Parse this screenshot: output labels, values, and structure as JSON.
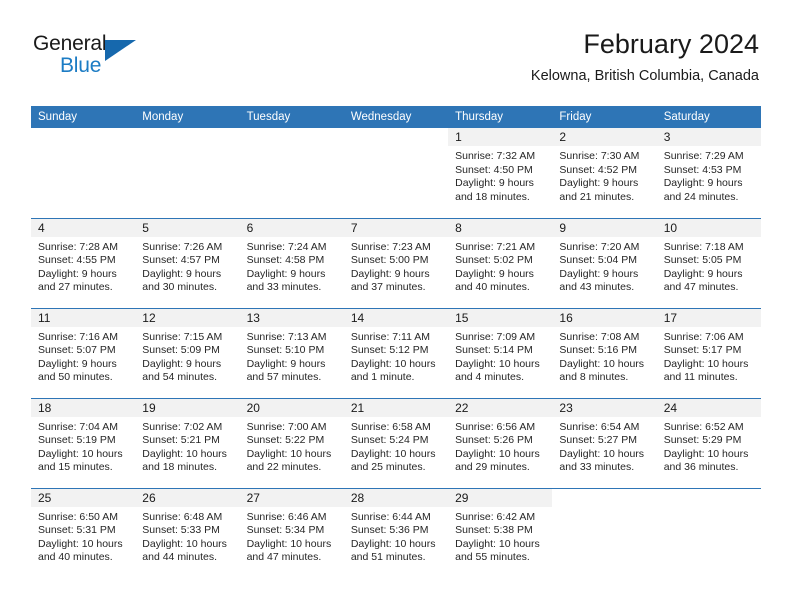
{
  "brand": {
    "name_part1": "General",
    "name_part2": "Blue",
    "accent_color": "#1668ad"
  },
  "header": {
    "title": "February 2024",
    "location": "Kelowna, British Columbia, Canada",
    "header_bg_color": "#2e75b6",
    "daynum_bg_color": "#f2f2f2"
  },
  "weekdays": [
    "Sunday",
    "Monday",
    "Tuesday",
    "Wednesday",
    "Thursday",
    "Friday",
    "Saturday"
  ],
  "weeks": [
    [
      {
        "day": "",
        "empty": true
      },
      {
        "day": "",
        "empty": true
      },
      {
        "day": "",
        "empty": true
      },
      {
        "day": "",
        "empty": true
      },
      {
        "day": "1",
        "sunrise": "Sunrise: 7:32 AM",
        "sunset": "Sunset: 4:50 PM",
        "daylight_line1": "Daylight: 9 hours",
        "daylight_line2": "and 18 minutes."
      },
      {
        "day": "2",
        "sunrise": "Sunrise: 7:30 AM",
        "sunset": "Sunset: 4:52 PM",
        "daylight_line1": "Daylight: 9 hours",
        "daylight_line2": "and 21 minutes."
      },
      {
        "day": "3",
        "sunrise": "Sunrise: 7:29 AM",
        "sunset": "Sunset: 4:53 PM",
        "daylight_line1": "Daylight: 9 hours",
        "daylight_line2": "and 24 minutes."
      }
    ],
    [
      {
        "day": "4",
        "sunrise": "Sunrise: 7:28 AM",
        "sunset": "Sunset: 4:55 PM",
        "daylight_line1": "Daylight: 9 hours",
        "daylight_line2": "and 27 minutes."
      },
      {
        "day": "5",
        "sunrise": "Sunrise: 7:26 AM",
        "sunset": "Sunset: 4:57 PM",
        "daylight_line1": "Daylight: 9 hours",
        "daylight_line2": "and 30 minutes."
      },
      {
        "day": "6",
        "sunrise": "Sunrise: 7:24 AM",
        "sunset": "Sunset: 4:58 PM",
        "daylight_line1": "Daylight: 9 hours",
        "daylight_line2": "and 33 minutes."
      },
      {
        "day": "7",
        "sunrise": "Sunrise: 7:23 AM",
        "sunset": "Sunset: 5:00 PM",
        "daylight_line1": "Daylight: 9 hours",
        "daylight_line2": "and 37 minutes."
      },
      {
        "day": "8",
        "sunrise": "Sunrise: 7:21 AM",
        "sunset": "Sunset: 5:02 PM",
        "daylight_line1": "Daylight: 9 hours",
        "daylight_line2": "and 40 minutes."
      },
      {
        "day": "9",
        "sunrise": "Sunrise: 7:20 AM",
        "sunset": "Sunset: 5:04 PM",
        "daylight_line1": "Daylight: 9 hours",
        "daylight_line2": "and 43 minutes."
      },
      {
        "day": "10",
        "sunrise": "Sunrise: 7:18 AM",
        "sunset": "Sunset: 5:05 PM",
        "daylight_line1": "Daylight: 9 hours",
        "daylight_line2": "and 47 minutes."
      }
    ],
    [
      {
        "day": "11",
        "sunrise": "Sunrise: 7:16 AM",
        "sunset": "Sunset: 5:07 PM",
        "daylight_line1": "Daylight: 9 hours",
        "daylight_line2": "and 50 minutes."
      },
      {
        "day": "12",
        "sunrise": "Sunrise: 7:15 AM",
        "sunset": "Sunset: 5:09 PM",
        "daylight_line1": "Daylight: 9 hours",
        "daylight_line2": "and 54 minutes."
      },
      {
        "day": "13",
        "sunrise": "Sunrise: 7:13 AM",
        "sunset": "Sunset: 5:10 PM",
        "daylight_line1": "Daylight: 9 hours",
        "daylight_line2": "and 57 minutes."
      },
      {
        "day": "14",
        "sunrise": "Sunrise: 7:11 AM",
        "sunset": "Sunset: 5:12 PM",
        "daylight_line1": "Daylight: 10 hours",
        "daylight_line2": "and 1 minute."
      },
      {
        "day": "15",
        "sunrise": "Sunrise: 7:09 AM",
        "sunset": "Sunset: 5:14 PM",
        "daylight_line1": "Daylight: 10 hours",
        "daylight_line2": "and 4 minutes."
      },
      {
        "day": "16",
        "sunrise": "Sunrise: 7:08 AM",
        "sunset": "Sunset: 5:16 PM",
        "daylight_line1": "Daylight: 10 hours",
        "daylight_line2": "and 8 minutes."
      },
      {
        "day": "17",
        "sunrise": "Sunrise: 7:06 AM",
        "sunset": "Sunset: 5:17 PM",
        "daylight_line1": "Daylight: 10 hours",
        "daylight_line2": "and 11 minutes."
      }
    ],
    [
      {
        "day": "18",
        "sunrise": "Sunrise: 7:04 AM",
        "sunset": "Sunset: 5:19 PM",
        "daylight_line1": "Daylight: 10 hours",
        "daylight_line2": "and 15 minutes."
      },
      {
        "day": "19",
        "sunrise": "Sunrise: 7:02 AM",
        "sunset": "Sunset: 5:21 PM",
        "daylight_line1": "Daylight: 10 hours",
        "daylight_line2": "and 18 minutes."
      },
      {
        "day": "20",
        "sunrise": "Sunrise: 7:00 AM",
        "sunset": "Sunset: 5:22 PM",
        "daylight_line1": "Daylight: 10 hours",
        "daylight_line2": "and 22 minutes."
      },
      {
        "day": "21",
        "sunrise": "Sunrise: 6:58 AM",
        "sunset": "Sunset: 5:24 PM",
        "daylight_line1": "Daylight: 10 hours",
        "daylight_line2": "and 25 minutes."
      },
      {
        "day": "22",
        "sunrise": "Sunrise: 6:56 AM",
        "sunset": "Sunset: 5:26 PM",
        "daylight_line1": "Daylight: 10 hours",
        "daylight_line2": "and 29 minutes."
      },
      {
        "day": "23",
        "sunrise": "Sunrise: 6:54 AM",
        "sunset": "Sunset: 5:27 PM",
        "daylight_line1": "Daylight: 10 hours",
        "daylight_line2": "and 33 minutes."
      },
      {
        "day": "24",
        "sunrise": "Sunrise: 6:52 AM",
        "sunset": "Sunset: 5:29 PM",
        "daylight_line1": "Daylight: 10 hours",
        "daylight_line2": "and 36 minutes."
      }
    ],
    [
      {
        "day": "25",
        "sunrise": "Sunrise: 6:50 AM",
        "sunset": "Sunset: 5:31 PM",
        "daylight_line1": "Daylight: 10 hours",
        "daylight_line2": "and 40 minutes."
      },
      {
        "day": "26",
        "sunrise": "Sunrise: 6:48 AM",
        "sunset": "Sunset: 5:33 PM",
        "daylight_line1": "Daylight: 10 hours",
        "daylight_line2": "and 44 minutes."
      },
      {
        "day": "27",
        "sunrise": "Sunrise: 6:46 AM",
        "sunset": "Sunset: 5:34 PM",
        "daylight_line1": "Daylight: 10 hours",
        "daylight_line2": "and 47 minutes."
      },
      {
        "day": "28",
        "sunrise": "Sunrise: 6:44 AM",
        "sunset": "Sunset: 5:36 PM",
        "daylight_line1": "Daylight: 10 hours",
        "daylight_line2": "and 51 minutes."
      },
      {
        "day": "29",
        "sunrise": "Sunrise: 6:42 AM",
        "sunset": "Sunset: 5:38 PM",
        "daylight_line1": "Daylight: 10 hours",
        "daylight_line2": "and 55 minutes."
      },
      {
        "day": "",
        "empty": true
      },
      {
        "day": "",
        "empty": true
      }
    ]
  ]
}
